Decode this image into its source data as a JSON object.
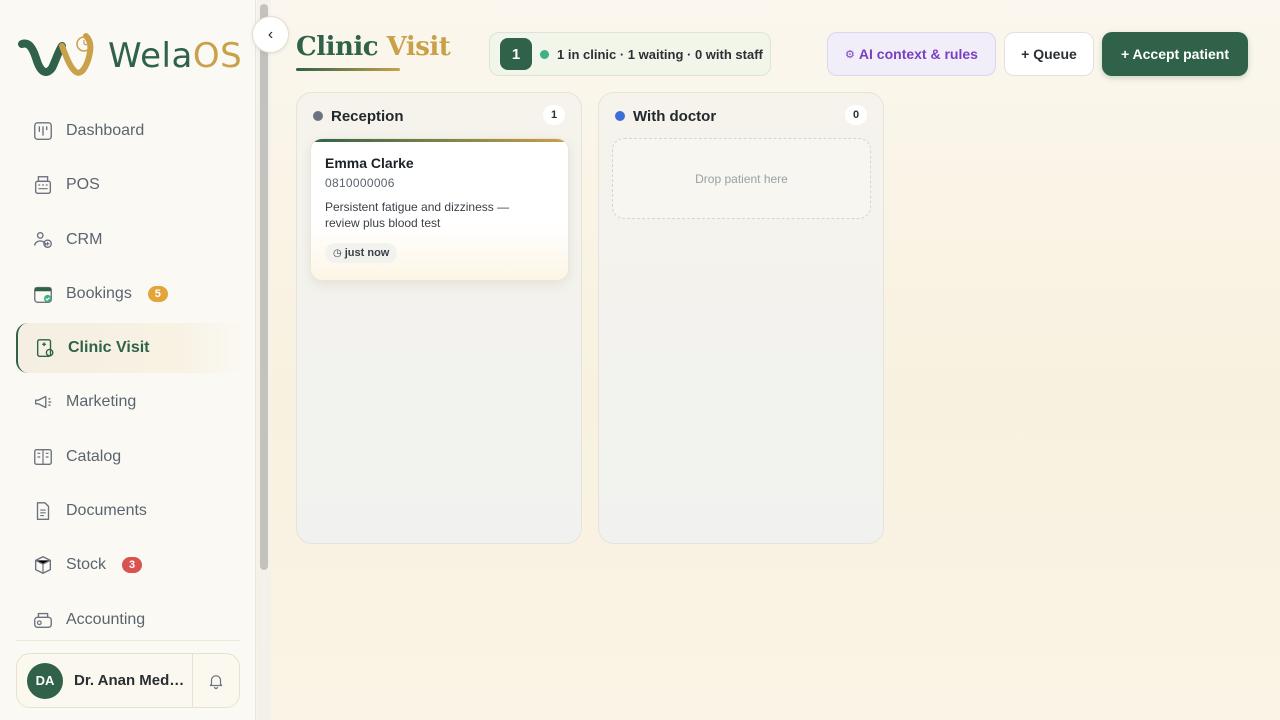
{
  "app": {
    "logo_text_main": "Wela",
    "logo_text_accent": "OS",
    "colors": {
      "brand_green": "#2f6248",
      "brand_gold": "#c9a14a"
    }
  },
  "sidebar": {
    "collapse_icon": "chevron-left-icon",
    "items": [
      {
        "label": "Dashboard",
        "icon": "dashboard-icon",
        "active": false,
        "badge": ""
      },
      {
        "label": "POS",
        "icon": "pos-register-icon",
        "active": false,
        "badge": ""
      },
      {
        "label": "CRM",
        "icon": "crm-users-icon",
        "active": false,
        "badge": ""
      },
      {
        "label": "Bookings",
        "icon": "calendar-check-icon",
        "active": false,
        "badge": "5"
      },
      {
        "label": "Clinic Visit",
        "icon": "clinic-icon",
        "active": true,
        "badge": ""
      },
      {
        "label": "Marketing",
        "icon": "megaphone-icon",
        "active": false,
        "badge": ""
      },
      {
        "label": "Catalog",
        "icon": "catalog-book-icon",
        "active": false,
        "badge": ""
      },
      {
        "label": "Documents",
        "icon": "document-icon",
        "active": false,
        "badge": ""
      },
      {
        "label": "Stock",
        "icon": "box-icon",
        "active": false,
        "badge": "3"
      },
      {
        "label": "Accounting",
        "icon": "cash-register-icon",
        "active": false,
        "badge": ""
      }
    ],
    "user": {
      "initials": "DA",
      "name": "Dr. Anan Medi…"
    }
  },
  "header": {
    "title_part1": "Clinic ",
    "title_part2": "Visit",
    "status": {
      "count": "1",
      "text": "1 in clinic · 1 waiting · 0 with staff"
    },
    "ai_button": "AI context & rules",
    "queue_button": "+ Queue",
    "accept_button": "+ Accept patient"
  },
  "columns": [
    {
      "title": "Reception",
      "count": "1",
      "dot_color": "#6b7280",
      "patients": [
        {
          "name": "Emma Clarke",
          "phone": "0810000006",
          "note": "Persistent fatigue and dizziness — review plus blood test",
          "time": "just now"
        }
      ]
    },
    {
      "title": "With doctor",
      "count": "0",
      "dot_color": "#3b6fd8",
      "dropzone": "Drop patient here"
    }
  ]
}
